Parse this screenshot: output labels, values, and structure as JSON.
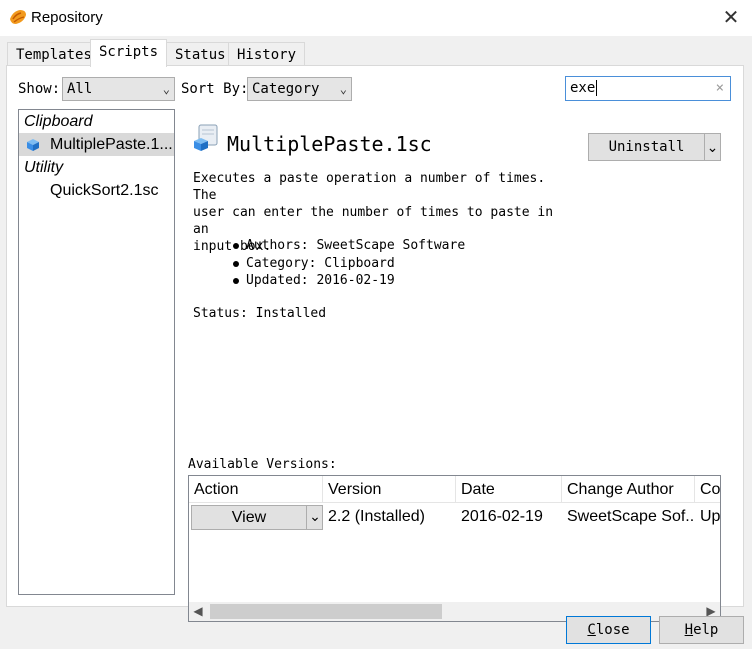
{
  "window": {
    "title": "Repository",
    "close_symbol": "✕"
  },
  "tabs": [
    {
      "label": "Templates",
      "active": false
    },
    {
      "label": "Scripts",
      "active": true
    },
    {
      "label": "Status",
      "active": false
    },
    {
      "label": "History",
      "active": false
    }
  ],
  "filters": {
    "show_label": "Show:",
    "show_value": "All",
    "sort_label": "Sort By:",
    "sort_value": "Category",
    "search_value": "exe",
    "search_clear": "×"
  },
  "tree": {
    "categories": [
      {
        "name": "Clipboard",
        "items": [
          {
            "label": "MultiplePaste.1...",
            "selected": true,
            "icon": "cube-icon"
          }
        ]
      },
      {
        "name": "Utility",
        "items": [
          {
            "label": "QuickSort2.1sc",
            "selected": false
          }
        ]
      }
    ]
  },
  "detail": {
    "title": "MultiplePaste.1sc",
    "action_button": "Uninstall",
    "description": "Executes a paste operation a number of times. The\nuser can enter the number of times to paste in an\ninput box.",
    "authors": "Authors: SweetScape Software",
    "category": "Category: Clipboard",
    "updated": "Updated: 2016-02-19",
    "status": "Status: Installed"
  },
  "versions": {
    "label": "Available Versions:",
    "columns": [
      "Action",
      "Version",
      "Date",
      "Change Author",
      "Co"
    ],
    "rows": [
      {
        "action": "View",
        "version": "2.2 (Installed)",
        "date": "2016-02-19",
        "author": "SweetScape Sof...",
        "comment": "Up"
      }
    ]
  },
  "footer": {
    "close_label": "Close",
    "close_accel": "C",
    "close_rest": "lose",
    "help_label": "Help",
    "help_accel": "H",
    "help_rest": "elp"
  },
  "colors": {
    "accent": "#4a8fd9",
    "selection": "#d9d9d9",
    "icon_orange": "#f29a1d",
    "icon_blue": "#3a8ee6"
  }
}
